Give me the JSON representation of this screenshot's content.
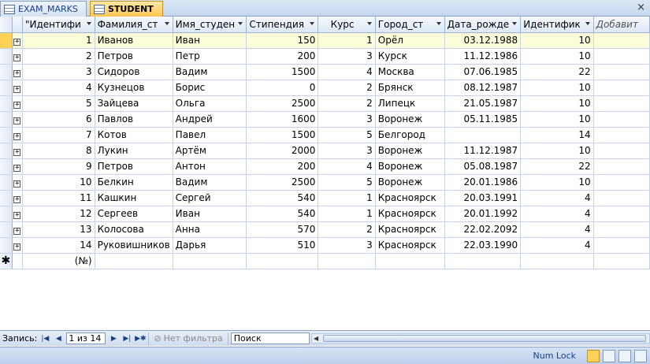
{
  "tabs": [
    {
      "label": "EXAM_MARKS",
      "active": false
    },
    {
      "label": "STUDENT",
      "active": true
    }
  ],
  "close_label": "×",
  "columns": [
    "\"Идентифи",
    "Фамилия_ст",
    "Имя_студен",
    "Стипендия",
    "Курс",
    "Город_ст",
    "Дата_рожде",
    "Идентифик",
    "Добавит"
  ],
  "rows": [
    [
      "1",
      "Иванов",
      "Иван",
      "150",
      "1",
      "Орёл",
      "03.12.1988",
      "10"
    ],
    [
      "2",
      "Петров",
      "Петр",
      "200",
      "3",
      "Курск",
      "11.12.1986",
      "10"
    ],
    [
      "3",
      "Сидоров",
      "Вадим",
      "1500",
      "4",
      "Москва",
      "07.06.1985",
      "22"
    ],
    [
      "4",
      "Кузнецов",
      "Борис",
      "0",
      "2",
      "Брянск",
      "08.12.1987",
      "10"
    ],
    [
      "5",
      "Зайцева",
      "Ольга",
      "2500",
      "2",
      "Липецк",
      "21.05.1987",
      "10"
    ],
    [
      "6",
      "Павлов",
      "Андрей",
      "1600",
      "3",
      "Воронеж",
      "05.11.1985",
      "10"
    ],
    [
      "7",
      "Котов",
      "Павел",
      "1500",
      "5",
      "Белгород",
      "",
      "14"
    ],
    [
      "8",
      "Лукин",
      "Артём",
      "2000",
      "3",
      "Воронеж",
      "11.12.1987",
      "10"
    ],
    [
      "9",
      "Петров",
      "Антон",
      "200",
      "4",
      "Воронеж",
      "05.08.1987",
      "22"
    ],
    [
      "10",
      "Белкин",
      "Вадим",
      "2500",
      "5",
      "Воронеж",
      "20.01.1986",
      "10"
    ],
    [
      "11",
      "Кашкин",
      "Сергей",
      "540",
      "1",
      "Красноярск",
      "20.03.1991",
      "4"
    ],
    [
      "12",
      "Сергеев",
      "Иван",
      "540",
      "1",
      "Красноярск",
      "20.01.1992",
      "4"
    ],
    [
      "13",
      "Колосова",
      "Анна",
      "570",
      "2",
      "Красноярск",
      "22.02.2092",
      "4"
    ],
    [
      "14",
      "Руковишников",
      "Дарья",
      "510",
      "3",
      "Красноярск",
      "22.03.1990",
      "4"
    ]
  ],
  "new_row_id": "(№)",
  "new_row_marker": "✱",
  "expand_glyph": "+",
  "nav": {
    "label": "Запись:",
    "current": "1 из 14",
    "filter": "Нет фильтра",
    "search": "Поиск"
  },
  "status": {
    "numlock": "Num Lock"
  },
  "colors": {
    "current_row": "#fcfdd9",
    "active_tab": "#ffc64f",
    "grid_line": "#c5d3e8"
  }
}
